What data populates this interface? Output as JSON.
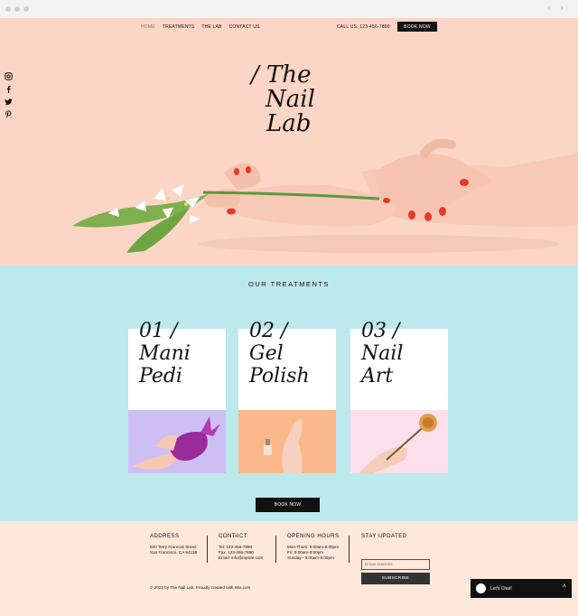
{
  "nav": {
    "items": [
      "HOME",
      "TREATMENTS",
      "THE LAB",
      "CONTACT US"
    ],
    "call": "CALL US:  123-456-7890",
    "book": "BOOK NOW"
  },
  "social": [
    "instagram-icon",
    "facebook-icon",
    "twitter-icon",
    "pinterest-icon"
  ],
  "hero": {
    "line1": "/ The",
    "line2": "Nail",
    "line3": "Lab"
  },
  "treatments": {
    "title": "OUR TREATMENTS",
    "cards": [
      {
        "num": "01 /",
        "line1": "Mani",
        "line2": "Pedi"
      },
      {
        "num": "02 /",
        "line1": "Gel",
        "line2": "Polish"
      },
      {
        "num": "03 /",
        "line1": "Nail",
        "line2": "Art"
      }
    ],
    "book": "BOOK NOW"
  },
  "footer": {
    "address": {
      "heading": "ADDRESS",
      "line1": "500 Terry Francois Street",
      "line2": "San Francisco, CA 94158"
    },
    "contact": {
      "heading": "CONTACT",
      "tel": "Tel: 123-456-7890",
      "fax": "Fax: 123-456-7890",
      "email": "Email: info@mysite.com"
    },
    "hours": {
      "heading": "OPENING HOURS",
      "line1": "Mon-Thurs: 9:00am-8:00pm",
      "line2": "Fri: 9:00am-8:00pm",
      "line3": "Sunday - 9:00am-8:00pm"
    },
    "stay": {
      "heading": "STAY UPDATED",
      "placeholder": "Email Address",
      "button": "SUBSCRIBE"
    },
    "copyright": "© 2023 by The Nail Lab. Proudly created with Wix.com"
  },
  "chat": {
    "label": "Let's Chat!"
  }
}
